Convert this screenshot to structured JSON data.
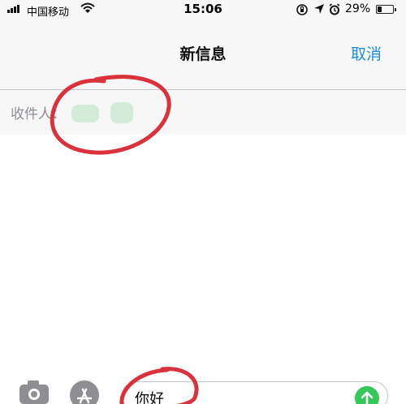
{
  "status_bar": {
    "carrier": "中国移动",
    "time": "15:06",
    "battery_percent": "29%",
    "battery_level": 0.29,
    "icons": [
      "signal-icon",
      "wifi-icon",
      "orientation-lock-icon",
      "location-icon",
      "alarm-icon",
      "battery-icon"
    ]
  },
  "nav": {
    "title": "新信息",
    "cancel_label": "取消"
  },
  "recipient": {
    "label": "收件人："
  },
  "composer": {
    "message_value": "你好",
    "icons": [
      "camera-icon",
      "app-store-icon",
      "send-icon"
    ]
  },
  "colors": {
    "accent": "#1a8fe0",
    "send": "#34c759",
    "annotation": "#d9323c",
    "bar_background": "#f7f7f7"
  }
}
